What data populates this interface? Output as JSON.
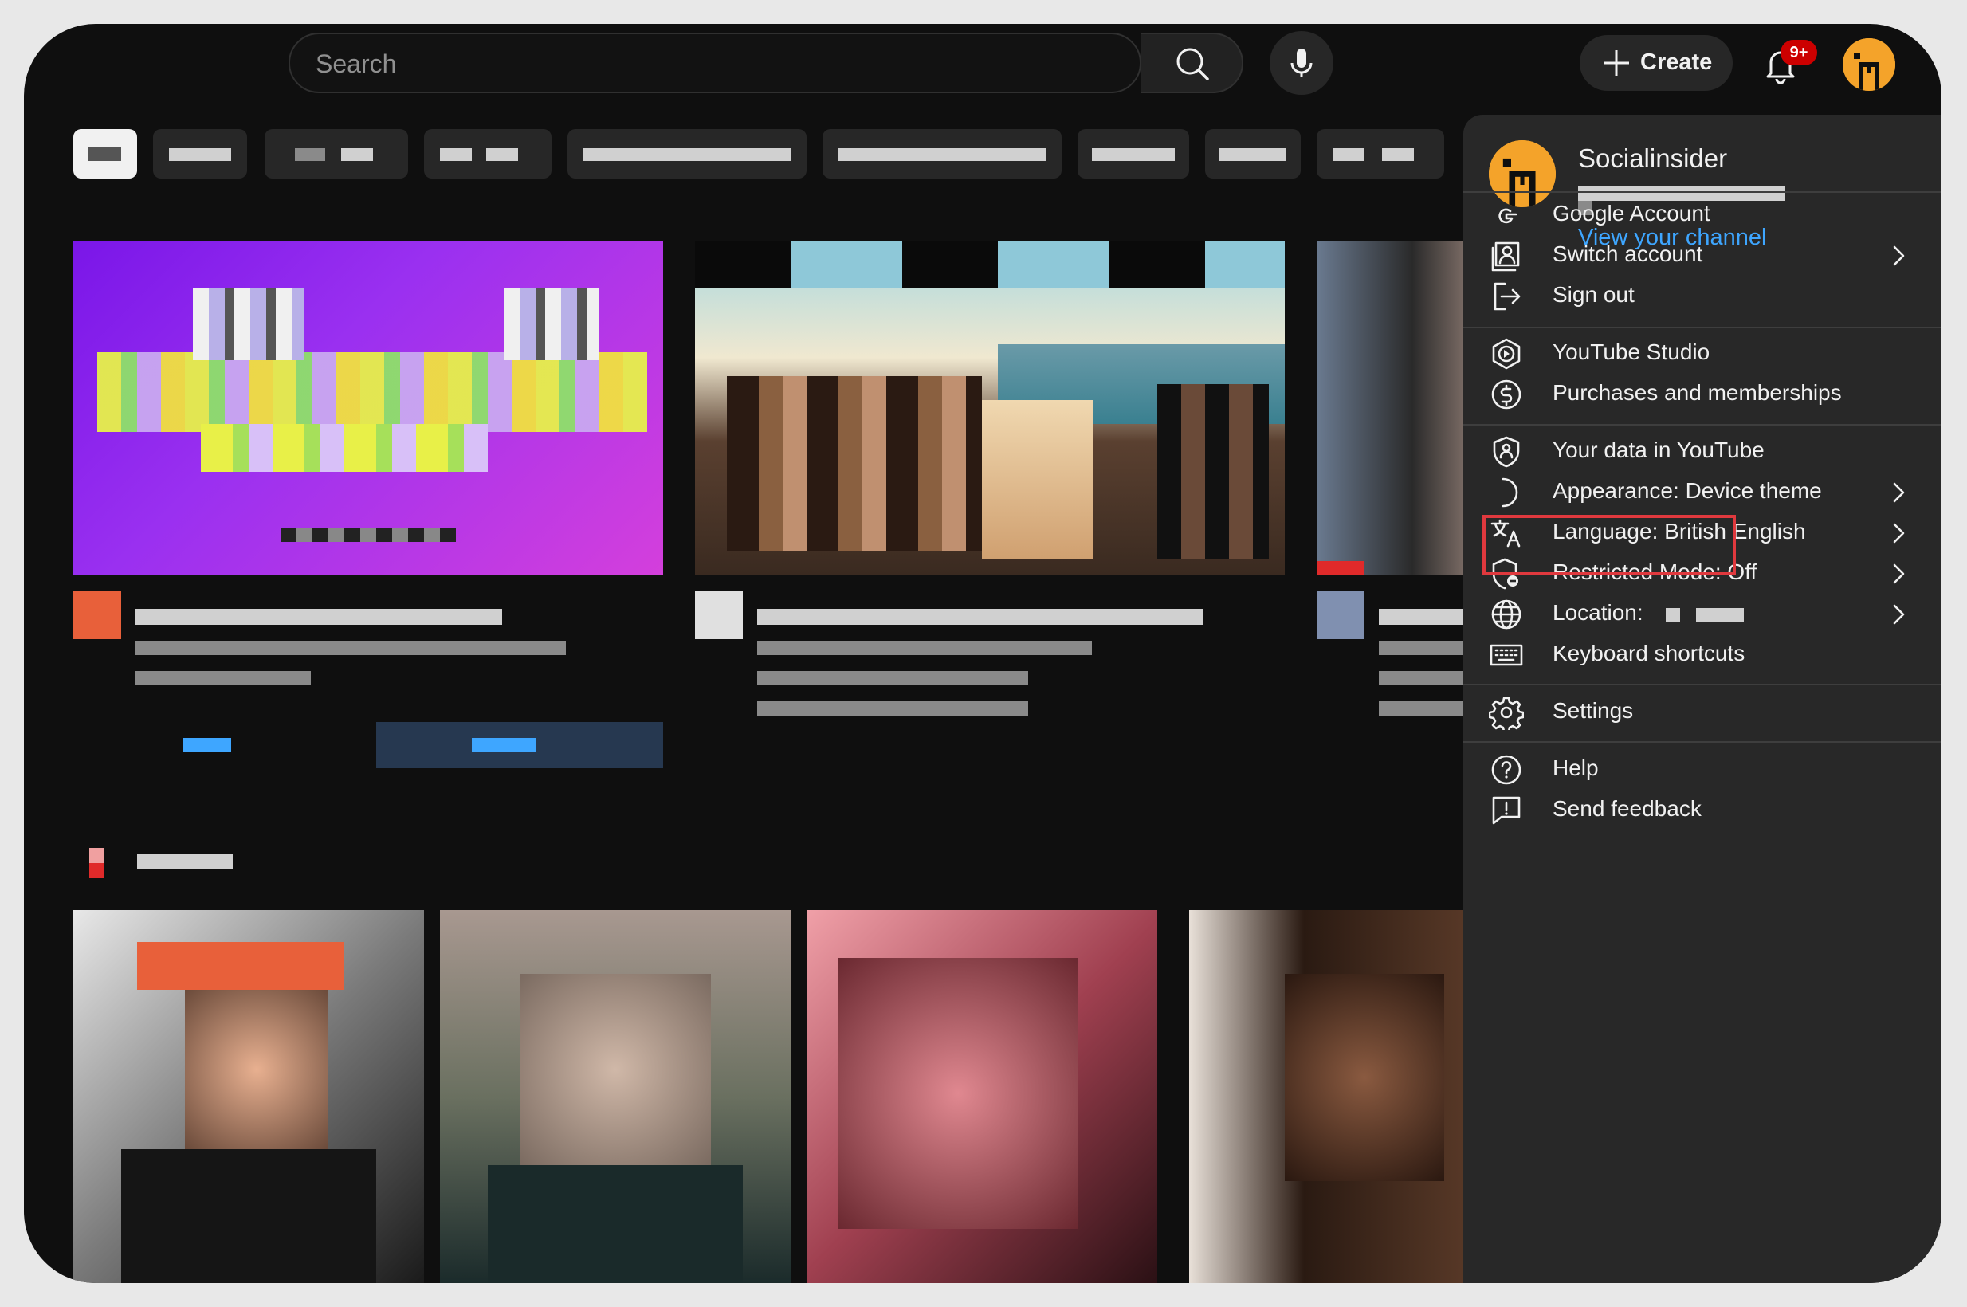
{
  "topbar": {
    "search_placeholder": "Search",
    "create_label": "Create",
    "notifications_badge": "9+"
  },
  "account_menu": {
    "user_name": "Socialinsider",
    "view_channel": "View your channel",
    "sections": [
      [
        {
          "label": "Google Account",
          "icon": "google-icon",
          "has_arrow": false
        },
        {
          "label": "Switch account",
          "icon": "switch-account-icon",
          "has_arrow": true
        },
        {
          "label": "Sign out",
          "icon": "sign-out-icon",
          "has_arrow": false
        }
      ],
      [
        {
          "label": "YouTube Studio",
          "icon": "youtube-studio-icon",
          "has_arrow": false,
          "highlighted": true
        },
        {
          "label": "Purchases and memberships",
          "icon": "purchases-icon",
          "has_arrow": false
        }
      ],
      [
        {
          "label": "Your data in YouTube",
          "icon": "data-shield-icon",
          "has_arrow": false
        },
        {
          "label": "Appearance: Device theme",
          "icon": "appearance-moon-icon",
          "has_arrow": true
        },
        {
          "label": "Language: British English",
          "icon": "language-icon",
          "has_arrow": true
        },
        {
          "label": "Restricted Mode: Off",
          "icon": "restricted-mode-icon",
          "has_arrow": true
        },
        {
          "label": "Location:",
          "icon": "globe-icon",
          "has_arrow": true
        },
        {
          "label": "Keyboard shortcuts",
          "icon": "keyboard-icon",
          "has_arrow": false
        }
      ],
      [
        {
          "label": "Settings",
          "icon": "settings-gear-icon",
          "has_arrow": false
        }
      ],
      [
        {
          "label": "Help",
          "icon": "help-icon",
          "has_arrow": false
        },
        {
          "label": "Send feedback",
          "icon": "feedback-icon",
          "has_arrow": false
        }
      ]
    ]
  },
  "colors": {
    "background": "#0f0f0f",
    "menu_background": "#282828",
    "link_blue": "#3ea6ff",
    "highlight_red": "#e0393e",
    "avatar_orange": "#f4a32a",
    "badge_red": "#cc0000"
  }
}
